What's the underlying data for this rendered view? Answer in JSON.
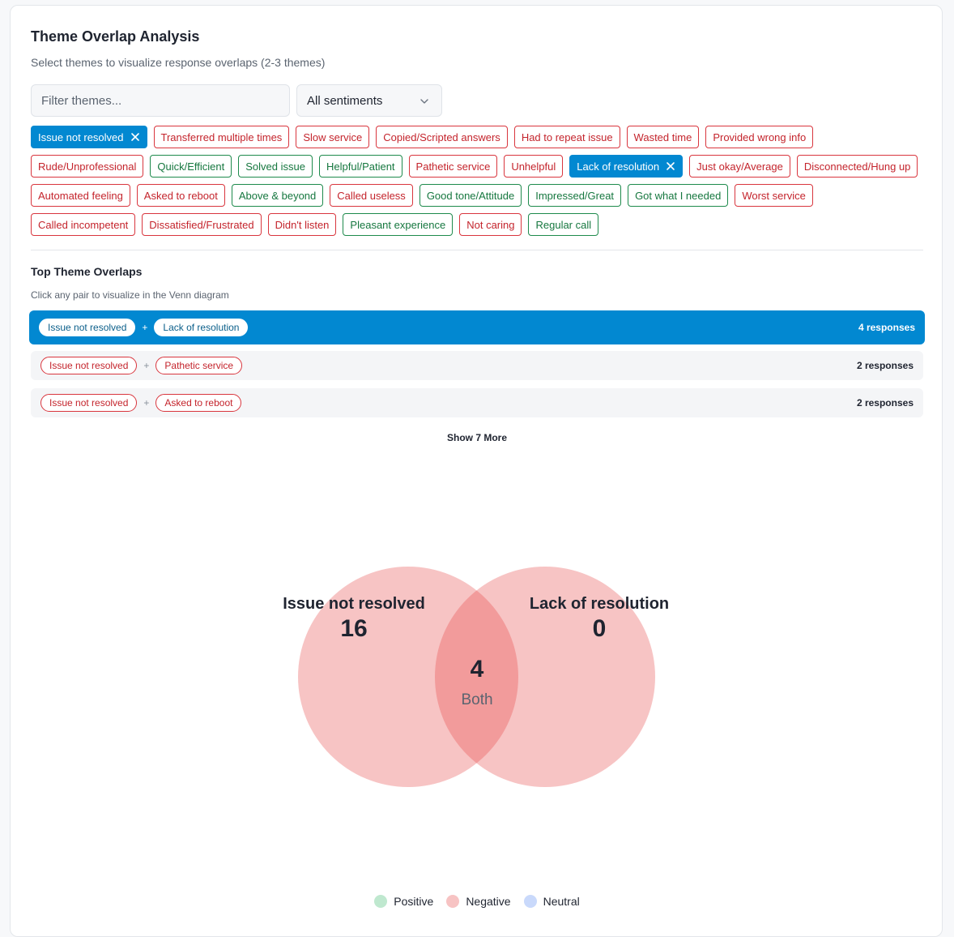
{
  "header": {
    "title": "Theme Overlap Analysis",
    "subtitle": "Select themes to visualize response overlaps (2-3 themes)"
  },
  "filters": {
    "search_placeholder": "Filter themes...",
    "sentiment_selected": "All sentiments"
  },
  "themes": {
    "rows": [
      [
        {
          "label": "Issue not resolved",
          "sentiment": "negative",
          "selected": true
        },
        {
          "label": "Transferred multiple times",
          "sentiment": "negative",
          "selected": false
        },
        {
          "label": "Slow service",
          "sentiment": "negative",
          "selected": false
        },
        {
          "label": "Copied/Scripted answers",
          "sentiment": "negative",
          "selected": false
        },
        {
          "label": "Had to repeat issue",
          "sentiment": "negative",
          "selected": false
        },
        {
          "label": "Wasted time",
          "sentiment": "negative",
          "selected": false
        },
        {
          "label": "Provided wrong info",
          "sentiment": "negative",
          "selected": false
        }
      ],
      [
        {
          "label": "Rude/Unprofessional",
          "sentiment": "negative",
          "selected": false
        },
        {
          "label": "Quick/Efficient",
          "sentiment": "positive",
          "selected": false
        },
        {
          "label": "Solved issue",
          "sentiment": "positive",
          "selected": false
        },
        {
          "label": "Helpful/Patient",
          "sentiment": "positive",
          "selected": false
        },
        {
          "label": "Pathetic service",
          "sentiment": "negative",
          "selected": false
        },
        {
          "label": "Unhelpful",
          "sentiment": "negative",
          "selected": false
        },
        {
          "label": "Lack of resolution",
          "sentiment": "negative",
          "selected": true
        },
        {
          "label": "Just okay/Average",
          "sentiment": "negative",
          "selected": false
        },
        {
          "label": "Disconnected/Hung up",
          "sentiment": "negative",
          "selected": false
        }
      ],
      [
        {
          "label": "Automated feeling",
          "sentiment": "negative",
          "selected": false
        },
        {
          "label": "Asked to reboot",
          "sentiment": "negative",
          "selected": false
        },
        {
          "label": "Above & beyond",
          "sentiment": "positive",
          "selected": false
        },
        {
          "label": "Called useless",
          "sentiment": "negative",
          "selected": false
        },
        {
          "label": "Good tone/Attitude",
          "sentiment": "positive",
          "selected": false
        },
        {
          "label": "Impressed/Great",
          "sentiment": "positive",
          "selected": false
        },
        {
          "label": "Got what I needed",
          "sentiment": "positive",
          "selected": false
        },
        {
          "label": "Worst service",
          "sentiment": "negative",
          "selected": false
        }
      ],
      [
        {
          "label": "Called incompetent",
          "sentiment": "negative",
          "selected": false
        },
        {
          "label": "Dissatisfied/Frustrated",
          "sentiment": "negative",
          "selected": false
        },
        {
          "label": "Didn't listen",
          "sentiment": "negative",
          "selected": false
        },
        {
          "label": "Pleasant experience",
          "sentiment": "positive",
          "selected": false
        },
        {
          "label": "Not caring",
          "sentiment": "negative",
          "selected": false
        },
        {
          "label": "Regular call",
          "sentiment": "positive",
          "selected": false
        }
      ]
    ]
  },
  "overlaps": {
    "title": "Top Theme Overlaps",
    "subtitle": "Click any pair to visualize in the Venn diagram",
    "pairs": [
      {
        "a": "Issue not resolved",
        "b": "Lack of resolution",
        "count": "4 responses",
        "active": true
      },
      {
        "a": "Issue not resolved",
        "b": "Pathetic service",
        "count": "2 responses",
        "active": false
      },
      {
        "a": "Issue not resolved",
        "b": "Asked to reboot",
        "count": "2 responses",
        "active": false
      }
    ],
    "plus": "+",
    "show_more": "Show 7 More"
  },
  "venn": {
    "left_label": "Issue not resolved",
    "left_count": "16",
    "right_label": "Lack of resolution",
    "right_count": "0",
    "both_count": "4",
    "both_label": "Both",
    "fill_color": "#f7b8b8",
    "overlap_color": "#f08c8c"
  },
  "legend": [
    {
      "label": "Positive",
      "color": "#bfe8cf"
    },
    {
      "label": "Negative",
      "color": "#f7c3c3"
    },
    {
      "label": "Neutral",
      "color": "#c9d9fb"
    }
  ],
  "colors": {
    "accent": "#0288d1",
    "negative": "#d9363e",
    "positive": "#1e8a4c"
  }
}
